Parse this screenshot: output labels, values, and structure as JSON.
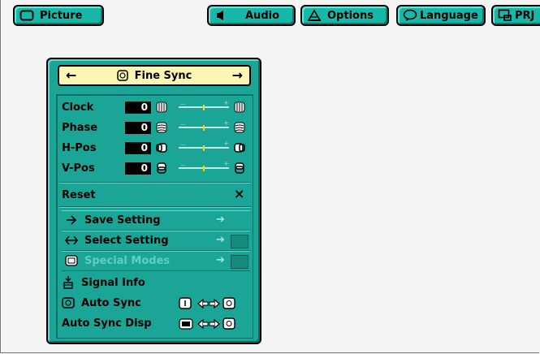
{
  "tabs": {
    "picture": "Picture",
    "audio": "Audio",
    "options": "Options",
    "language": "Language",
    "prj": "PRJ"
  },
  "panel": {
    "title": "Fine Sync",
    "adjustments": [
      {
        "label": "Clock",
        "value": "0",
        "level": 0.5
      },
      {
        "label": "Phase",
        "value": "0",
        "level": 0.5
      },
      {
        "label": "H-Pos",
        "value": "0",
        "level": 0.5
      },
      {
        "label": "V-Pos",
        "value": "0",
        "level": 0.5
      }
    ],
    "reset": {
      "label": "Reset",
      "icon": "close-icon",
      "symbol": "×"
    },
    "menu": {
      "save_setting": "Save Setting",
      "select_setting": "Select Setting",
      "special_modes": "Special Modes",
      "signal_info": "Signal Info",
      "auto_sync": "Auto Sync",
      "auto_sync_disp": "Auto Sync Disp"
    }
  },
  "colors": {
    "panel": "#1aa596",
    "title_bg": "#fbf6b4",
    "tab": "#18b8a8",
    "disabled_text": "#5ecfc2",
    "slider_knob": "#ffd000"
  }
}
